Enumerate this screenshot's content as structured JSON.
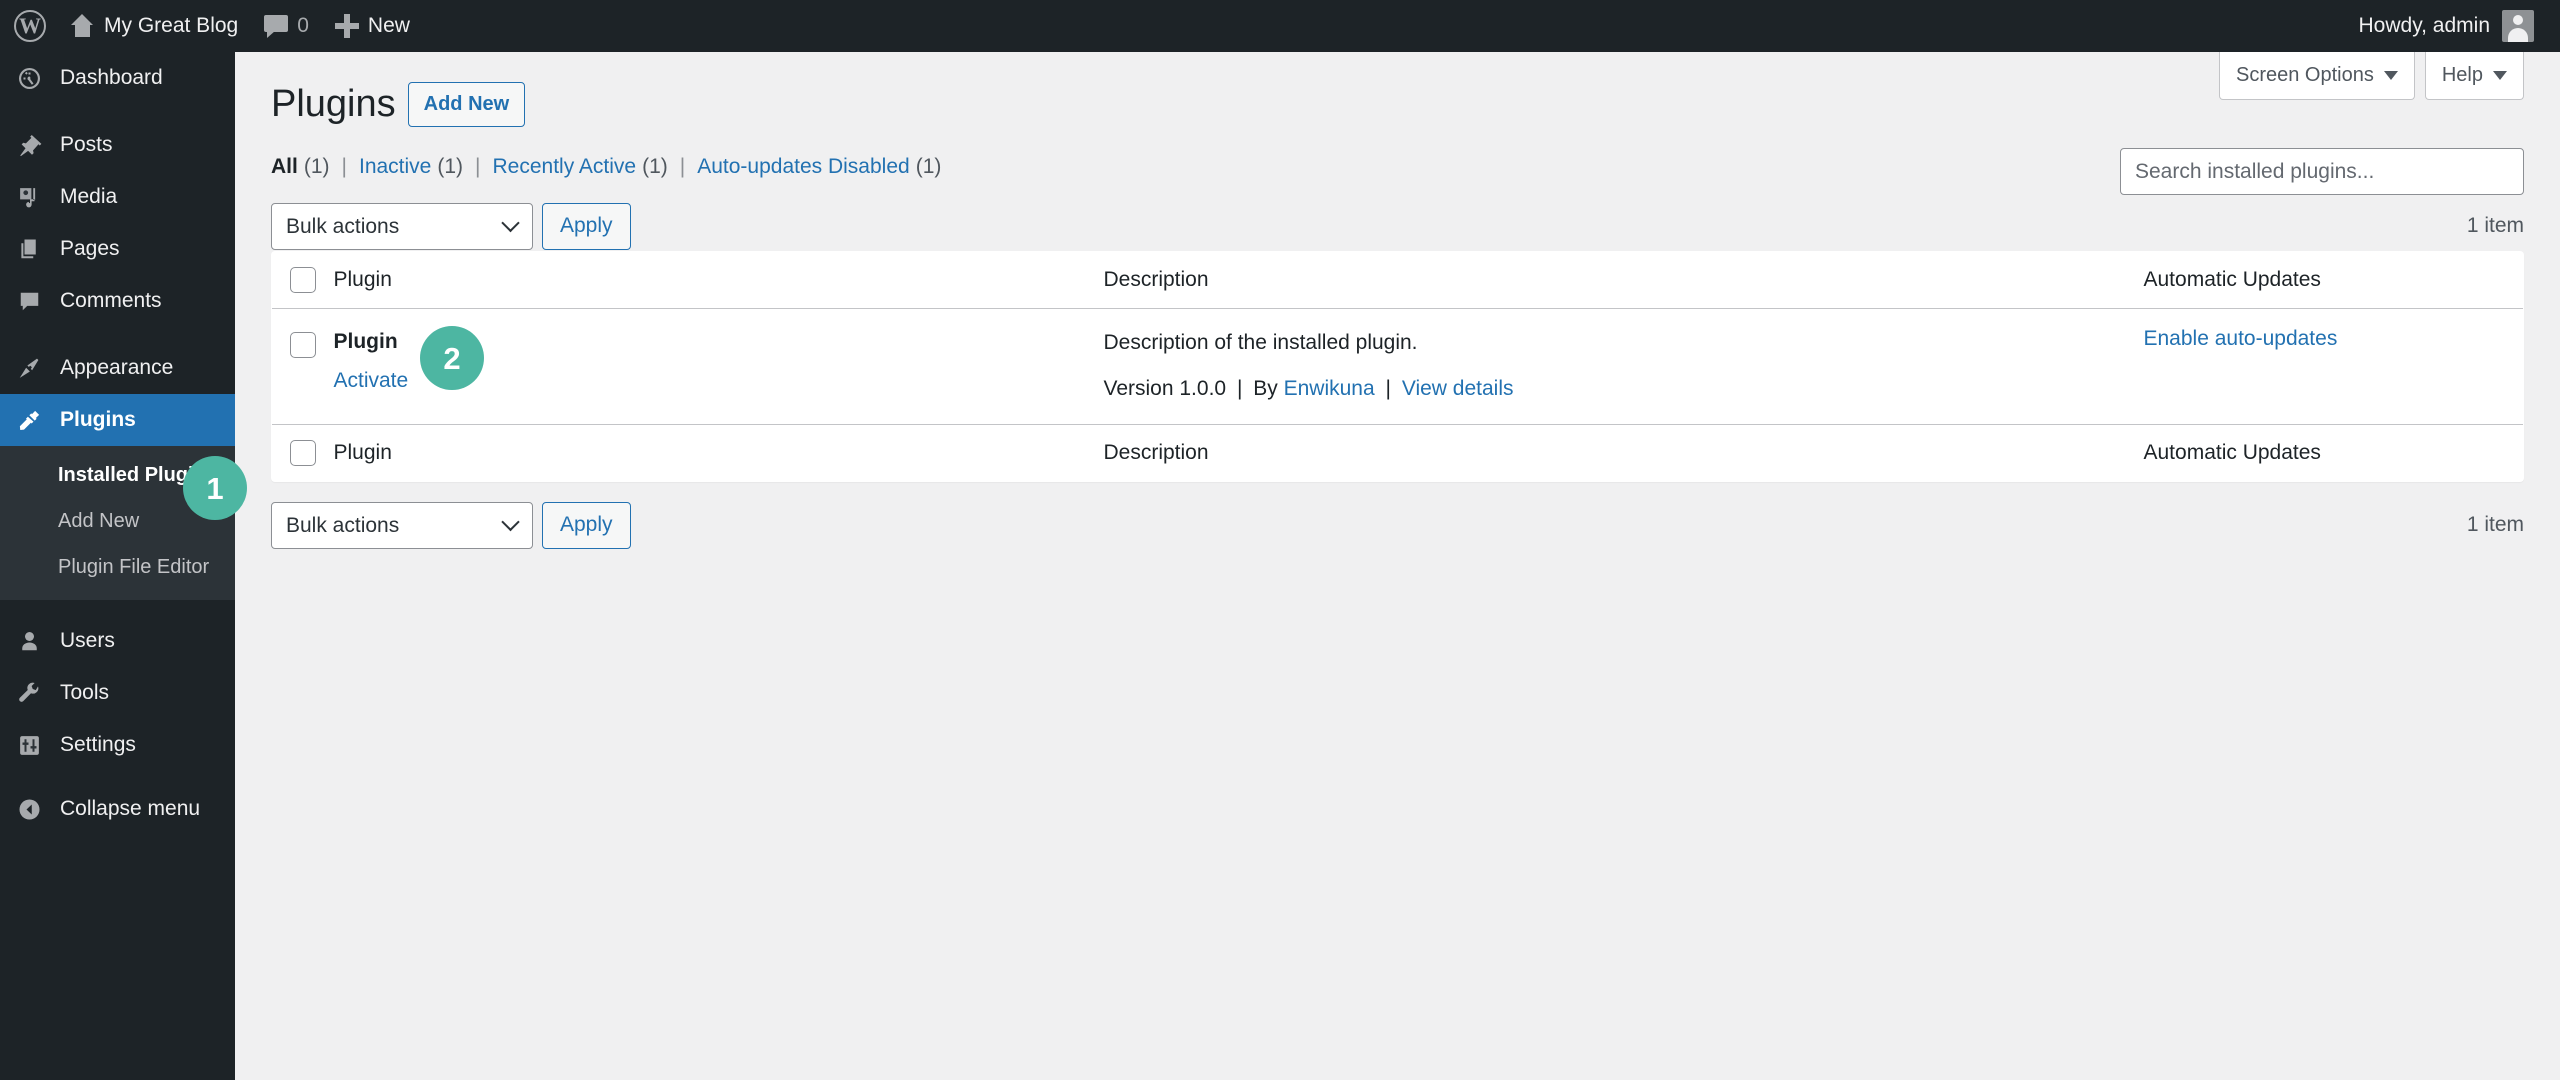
{
  "adminbar": {
    "logo_icon": "wordpress-logo-icon",
    "site_name": "My Great Blog",
    "home_icon": "home-icon",
    "comments_icon": "comment-bubble-icon",
    "comments_count": "0",
    "new_icon": "plus-icon",
    "new_label": "New",
    "howdy": "Howdy, admin",
    "avatar_icon": "user-avatar-icon"
  },
  "sidebar": {
    "items": [
      {
        "label": "Dashboard",
        "icon": "dashboard-icon"
      },
      {
        "label": "Posts",
        "icon": "pin-icon"
      },
      {
        "label": "Media",
        "icon": "media-icon"
      },
      {
        "label": "Pages",
        "icon": "pages-icon"
      },
      {
        "label": "Comments",
        "icon": "comment-bubble-icon"
      },
      {
        "label": "Appearance",
        "icon": "paintbrush-icon"
      },
      {
        "label": "Plugins",
        "icon": "plug-icon"
      },
      {
        "label": "Users",
        "icon": "user-icon"
      },
      {
        "label": "Tools",
        "icon": "wrench-icon"
      },
      {
        "label": "Settings",
        "icon": "sliders-icon"
      },
      {
        "label": "Collapse menu",
        "icon": "collapse-arrow-icon"
      }
    ],
    "submenu": [
      {
        "label": "Installed Plugins"
      },
      {
        "label": "Add New"
      },
      {
        "label": "Plugin File Editor"
      }
    ]
  },
  "screen_meta": {
    "screen_options": "Screen Options",
    "help": "Help"
  },
  "page": {
    "title": "Plugins",
    "add_new": "Add New"
  },
  "filters": [
    {
      "label": "All",
      "count": "(1)",
      "current": true
    },
    {
      "label": "Inactive",
      "count": "(1)",
      "current": false
    },
    {
      "label": "Recently Active",
      "count": "(1)",
      "current": false
    },
    {
      "label": "Auto-updates Disabled",
      "count": "(1)",
      "current": false
    }
  ],
  "separator": "|",
  "search": {
    "placeholder": "Search installed plugins...",
    "value": ""
  },
  "tablenav_top": {
    "bulk_label": "Bulk actions",
    "apply": "Apply",
    "displaying": "1 item"
  },
  "tablenav_bottom": {
    "bulk_label": "Bulk actions",
    "apply": "Apply",
    "displaying": "1 item"
  },
  "table": {
    "columns": {
      "plugin": "Plugin",
      "description": "Description",
      "automatic_updates": "Automatic Updates"
    },
    "rows": [
      {
        "name": "Plugin",
        "action": "Activate",
        "description": "Description of the installed plugin.",
        "version": "Version 1.0.0",
        "by_label": "By",
        "author": "Enwikuna",
        "view_details": "View details",
        "auto_updates": "Enable auto-updates"
      }
    ]
  },
  "annotations": [
    {
      "number": "1"
    },
    {
      "number": "2"
    }
  ],
  "colors": {
    "adminbar_bg": "#1d2327",
    "sidebar_bg": "#1d2327",
    "submenu_bg": "#2c3338",
    "accent_blue": "#2271b1",
    "current_menu_bg": "#2271b1",
    "content_bg": "#f0f0f1",
    "annotation_green": "#4db6a2"
  }
}
